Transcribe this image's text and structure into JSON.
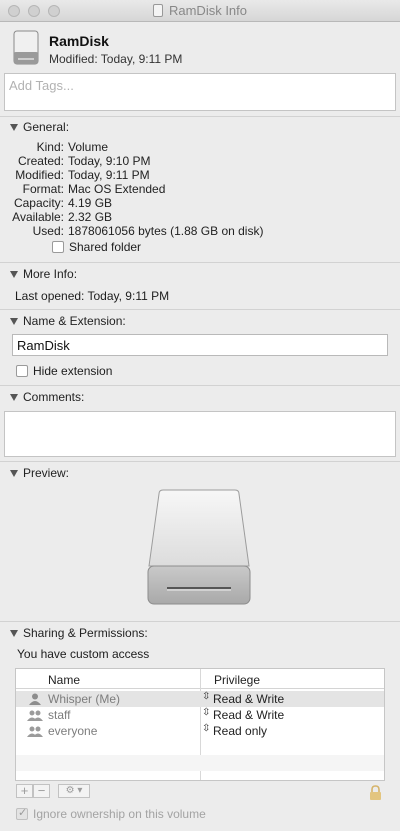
{
  "window": {
    "title": "RamDisk Info"
  },
  "header": {
    "name": "RamDisk",
    "modified": "Modified: Today, 9:11 PM"
  },
  "tags": {
    "placeholder": "Add Tags..."
  },
  "general": {
    "heading": "General:",
    "rows": [
      {
        "label": "Kind:",
        "value": "Volume"
      },
      {
        "label": "Created:",
        "value": "Today, 9:10 PM"
      },
      {
        "label": "Modified:",
        "value": "Today, 9:11 PM"
      },
      {
        "label": "Format:",
        "value": "Mac OS Extended"
      },
      {
        "label": "Capacity:",
        "value": "4.19 GB"
      },
      {
        "label": "Available:",
        "value": "2.32 GB"
      },
      {
        "label": "Used:",
        "value": "1878061056 bytes (1.88 GB on disk)"
      }
    ],
    "shared_folder": "Shared folder"
  },
  "more_info": {
    "heading": "More Info:",
    "last_opened": "Last opened: Today, 9:11 PM"
  },
  "name_ext": {
    "heading": "Name & Extension:",
    "value": "RamDisk",
    "hide_extension": "Hide extension"
  },
  "comments": {
    "heading": "Comments:"
  },
  "preview": {
    "heading": "Preview:"
  },
  "sharing": {
    "heading": "Sharing & Permissions:",
    "access": "You have custom access",
    "col_name": "Name",
    "col_privilege": "Privilege",
    "rows": [
      {
        "name": "Whisper (Me)",
        "privilege": "Read & Write",
        "icon": "user-icon"
      },
      {
        "name": "staff",
        "privilege": "Read & Write",
        "icon": "group-icon"
      },
      {
        "name": "everyone",
        "privilege": "Read only",
        "icon": "group-icon"
      }
    ],
    "add": "+",
    "remove": "−",
    "gear": "⚙ ▾",
    "ignore_ownership": "Ignore ownership on this volume"
  }
}
